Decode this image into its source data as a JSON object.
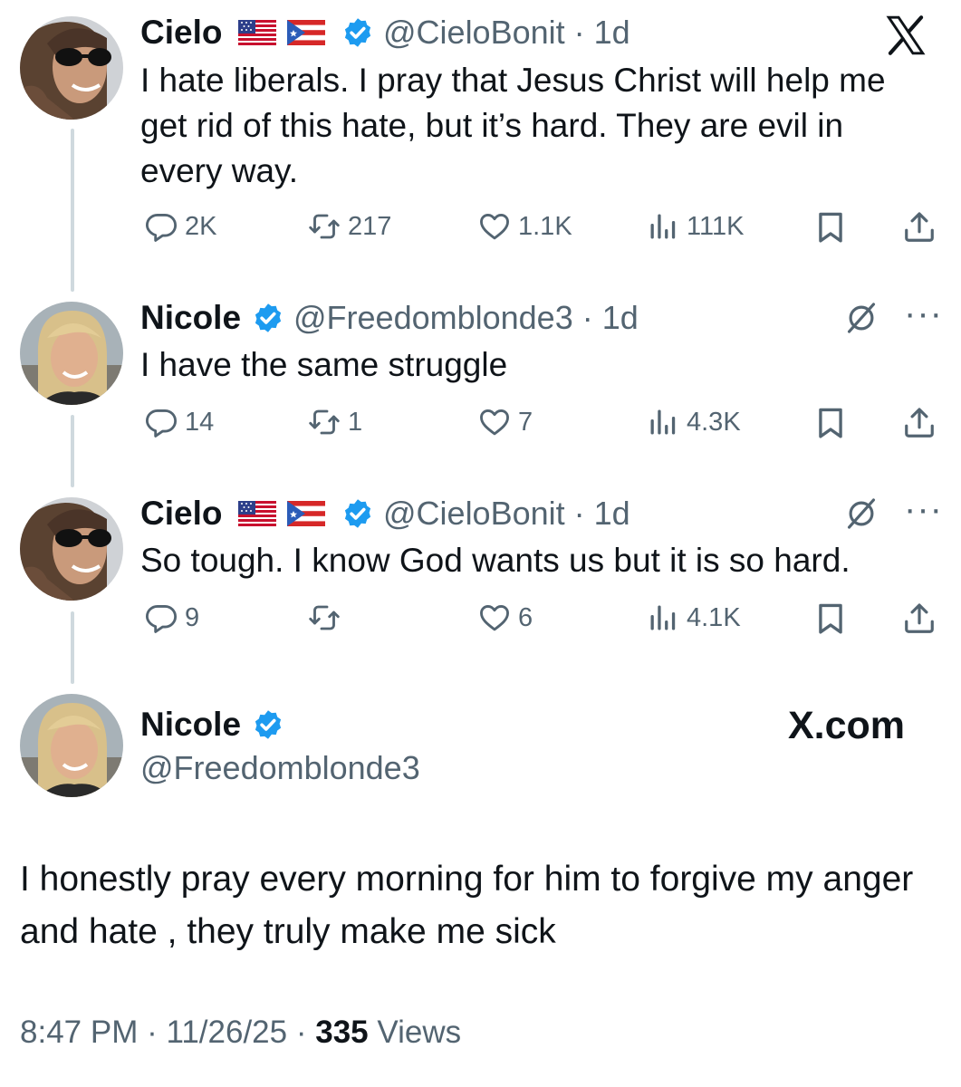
{
  "logo": "X",
  "watermark": "X.com",
  "tweets": [
    {
      "name": "Cielo",
      "flags": [
        "us-flag",
        "puerto-rico-flag"
      ],
      "handle": "@CieloBonit",
      "time": "1d",
      "text": "I hate liberals. I pray that Jesus Christ will help me get rid of this hate, but it’s hard. They are evil in every way.",
      "replies": "2K",
      "reposts": "217",
      "likes": "1.1K",
      "views": "111K"
    },
    {
      "name": "Nicole",
      "handle": "@Freedomblonde3",
      "time": "1d",
      "text": "I have the same struggle",
      "replies": "14",
      "reposts": "1",
      "likes": "7",
      "views": "4.3K"
    },
    {
      "name": "Cielo",
      "flags": [
        "us-flag",
        "puerto-rico-flag"
      ],
      "handle": "@CieloBonit",
      "time": "1d",
      "text": "So tough. I know God wants us but it is so hard.",
      "replies": "9",
      "reposts": "",
      "likes": "6",
      "views": "4.1K"
    }
  ],
  "main": {
    "name": "Nicole",
    "handle": "@Freedomblonde3",
    "text": "I honestly pray every morning for him to forgive my anger and hate , they truly make me sick",
    "time": "8:47 PM",
    "date": "11/26/25",
    "views_count": "335",
    "views_label": "Views"
  },
  "colors": {
    "verified": "#1d9bf0",
    "muted": "#536471",
    "text": "#0f1419",
    "thread": "#cfd9de"
  },
  "icons": [
    "reply-icon",
    "repost-icon",
    "like-icon",
    "views-icon",
    "bookmark-icon",
    "share-icon",
    "grok-icon",
    "more-icon",
    "verified-icon"
  ]
}
